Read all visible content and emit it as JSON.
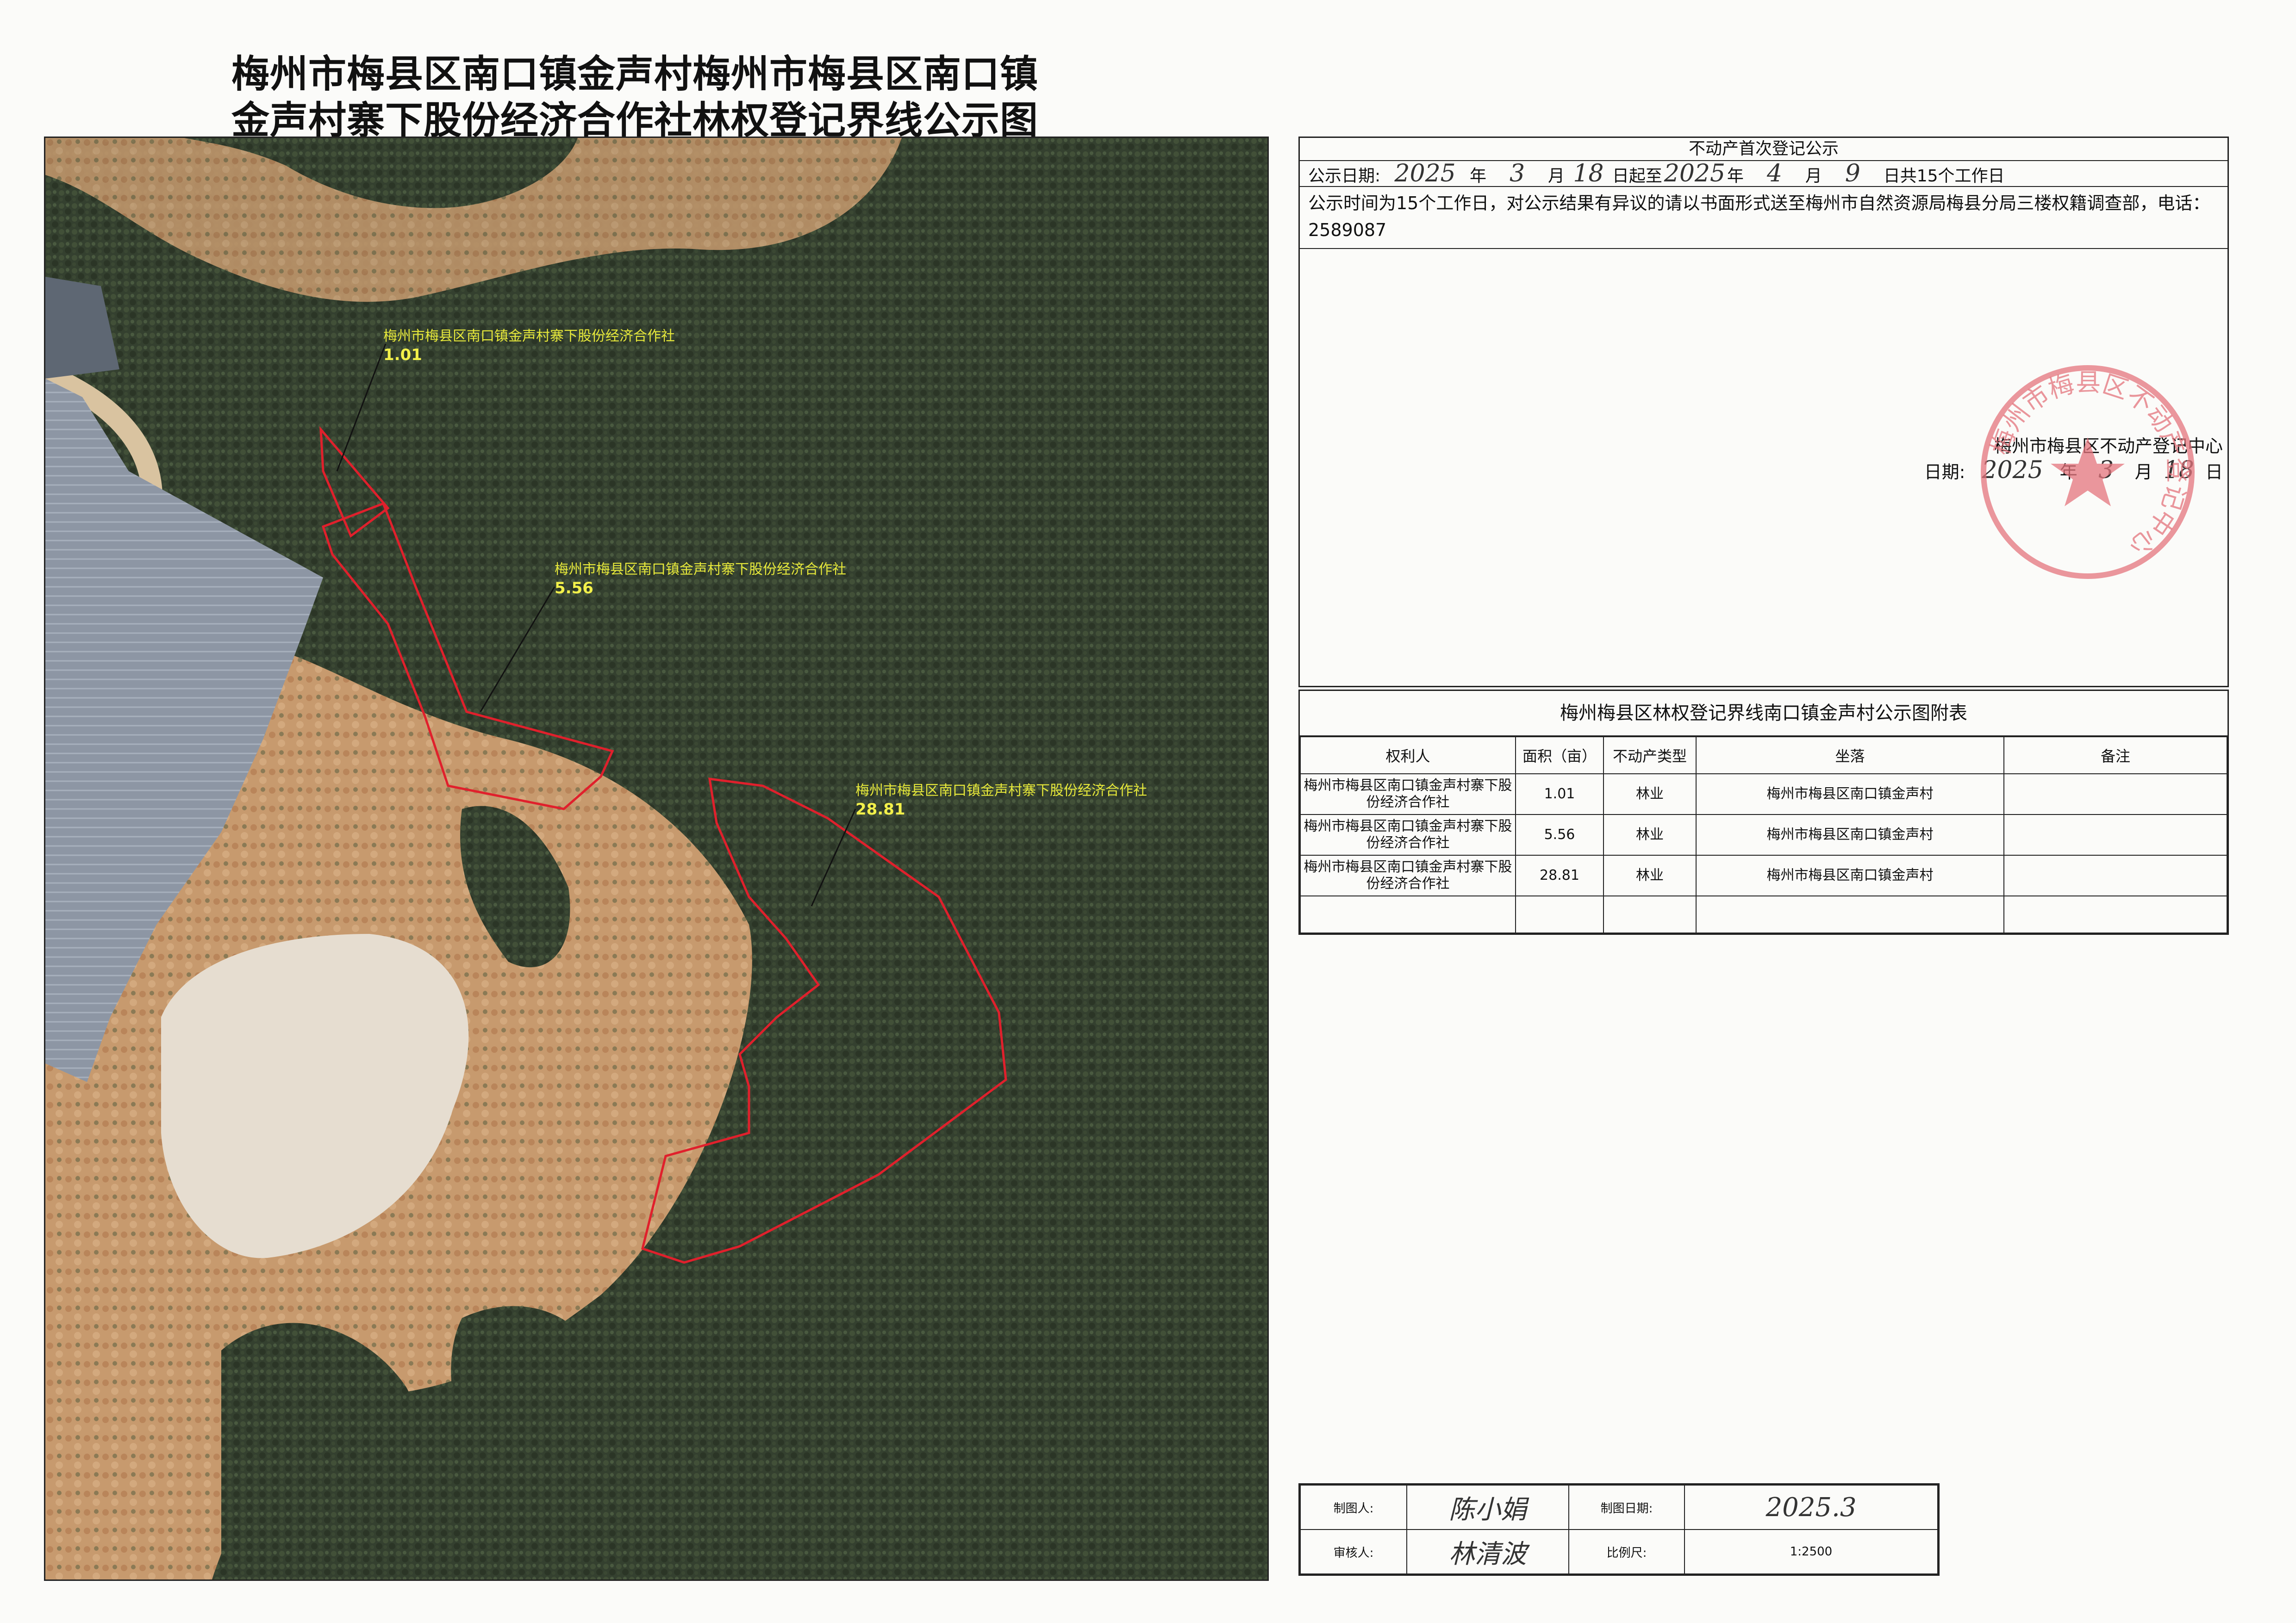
{
  "title_line1": "梅州市梅县区南口镇金声村梅州市梅县区南口镇",
  "title_line2": "金声村寨下股份经济合作社林权登记界线公示图",
  "map": {
    "parcels": [
      {
        "label": "梅州市梅县区南口镇金声村寨下股份经济合作社",
        "area": "1.01"
      },
      {
        "label": "梅州市梅县区南口镇金声村寨下股份经济合作社",
        "area": "5.56"
      },
      {
        "label": "梅州市梅县区南口镇金声村寨下股份经济合作社",
        "area": "28.81"
      }
    ],
    "boundary_color": "#e0202c",
    "label_color": "#e6e83a"
  },
  "notice": {
    "heading": "不动产首次登记公示",
    "date_prefix": "公示日期:",
    "start_year": "2025",
    "year_char": "年",
    "start_month": "3",
    "month_char": "月",
    "start_day": "18",
    "day_from": "日起至",
    "end_year": "2025",
    "end_month": "4",
    "end_day": "9",
    "day_total": "日共15个工作日",
    "body": "公示时间为15个工作日，对公示结果有异议的请以书面形式送至梅州市自然资源局梅县分局三楼权籍调查部，电话：2589087",
    "center": "梅州市梅县区不动产登记中心",
    "sign_date_label": "日期:",
    "sign_year": "2025",
    "sign_month": "3",
    "sign_day": "18",
    "day_char": "日",
    "seal_text": "梅州市梅县区不动产登记中心"
  },
  "attachment": {
    "title": "梅州梅县区林权登记界线南口镇金声村公示图附表",
    "headers": [
      "权利人",
      "面积（亩）",
      "不动产类型",
      "坐落",
      "备注"
    ],
    "rows": [
      {
        "holder": "梅州市梅县区南口镇金声村寨下股份经济合作社",
        "area": "1.01",
        "type": "林业",
        "location": "梅州市梅县区南口镇金声村",
        "note": ""
      },
      {
        "holder": "梅州市梅县区南口镇金声村寨下股份经济合作社",
        "area": "5.56",
        "type": "林业",
        "location": "梅州市梅县区南口镇金声村",
        "note": ""
      },
      {
        "holder": "梅州市梅县区南口镇金声村寨下股份经济合作社",
        "area": "28.81",
        "type": "林业",
        "location": "梅州市梅县区南口镇金声村",
        "note": ""
      }
    ]
  },
  "signoff": {
    "maker_label": "制图人:",
    "maker": "陈小娟",
    "date_label": "制图日期:",
    "date": "2025.3",
    "reviewer_label": "审核人:",
    "reviewer": "林清波",
    "scale_label": "比例尺:",
    "scale": "1:2500"
  }
}
